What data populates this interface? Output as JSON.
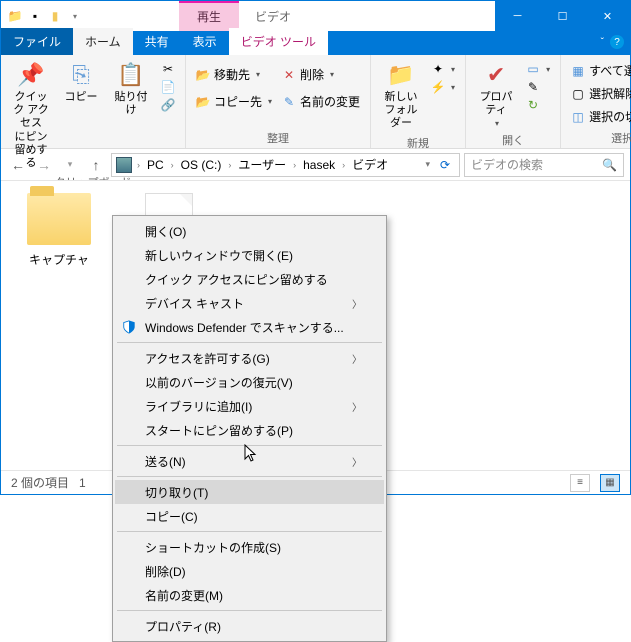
{
  "titlebar": {
    "ctx_tab": "再生",
    "ctx_label": "ビデオ"
  },
  "tabs": {
    "file": "ファイル",
    "home": "ホーム",
    "share": "共有",
    "view": "表示",
    "video_tools": "ビデオ ツール"
  },
  "ribbon": {
    "clipboard": {
      "pin": "クイック アクセス\nにピン留めする",
      "copy": "コピー",
      "paste": "貼り付け",
      "group": "クリップボード"
    },
    "organize": {
      "move_to": "移動先",
      "delete": "削除",
      "copy_to": "コピー先",
      "rename": "名前の変更",
      "group": "整理"
    },
    "new": {
      "new_folder": "新しい\nフォルダー",
      "group": "新規"
    },
    "open": {
      "properties": "プロパティ",
      "group": "開く"
    },
    "select": {
      "all": "すべて選択",
      "none": "選択解除",
      "invert": "選択の切り替え",
      "group": "選択"
    }
  },
  "breadcrumb": {
    "pc": "PC",
    "drive": "OS (C:)",
    "users": "ユーザー",
    "user": "hasek",
    "videos": "ビデオ"
  },
  "search": {
    "placeholder": "ビデオの検索"
  },
  "items": {
    "folder1": "キャプチャ"
  },
  "status": {
    "count": "2 個の項目",
    "selected": "1"
  },
  "context": {
    "open": "開く(O)",
    "open_new_window": "新しいウィンドウで開く(E)",
    "pin_quick": "クイック アクセスにピン留めする",
    "cast": "デバイス キャスト",
    "defender": "Windows Defender でスキャンする...",
    "grant_access": "アクセスを許可する(G)",
    "restore": "以前のバージョンの復元(V)",
    "library": "ライブラリに追加(I)",
    "pin_start": "スタートにピン留めする(P)",
    "send_to": "送る(N)",
    "cut": "切り取り(T)",
    "copy": "コピー(C)",
    "shortcut": "ショートカットの作成(S)",
    "delete": "削除(D)",
    "rename": "名前の変更(M)",
    "properties": "プロパティ(R)"
  }
}
